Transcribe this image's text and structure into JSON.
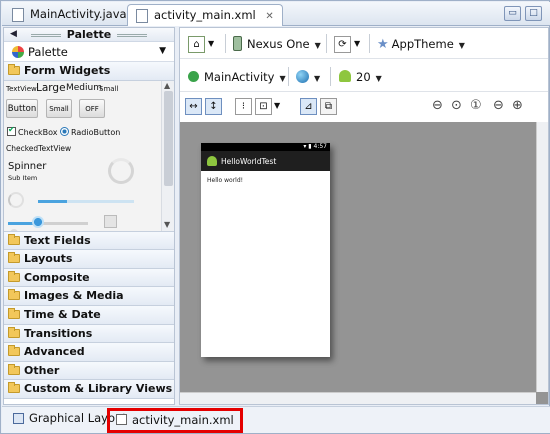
{
  "editor_tabs": [
    {
      "label": "MainActivity.java",
      "active": false
    },
    {
      "label": "activity_main.xml",
      "active": true,
      "close": "✕"
    }
  ],
  "palette": {
    "header": "Palette",
    "selector": "Palette",
    "open_category": "Form Widgets",
    "widgets": {
      "textview": "TextView",
      "large": "Large",
      "medium": "Medium",
      "small": "Small",
      "button": "Button",
      "small_button": "Small",
      "toggle": "OFF",
      "checkbox": "CheckBox",
      "radio": "RadioButton",
      "checked_textview": "CheckedTextView",
      "spinner": "Spinner",
      "sub_item": "Sub Item"
    },
    "categories": [
      "Text Fields",
      "Layouts",
      "Composite",
      "Images & Media",
      "Time & Date",
      "Transitions",
      "Advanced",
      "Other",
      "Custom & Library Views"
    ]
  },
  "toolbar1": {
    "device": "Nexus One",
    "theme": "AppTheme"
  },
  "toolbar2": {
    "activity": "MainActivity",
    "api": "20"
  },
  "device_preview": {
    "time": "4:57",
    "app_title": "HelloWorldTest",
    "content_text": "Hello world!"
  },
  "bottom_tabs": [
    {
      "label": "Graphical Layout",
      "highlighted": false
    },
    {
      "label": "activity_main.xml",
      "highlighted": true
    }
  ],
  "colors": {
    "highlight": "#e40000",
    "canvas": "#949494",
    "android_green": "#8ec63f"
  }
}
